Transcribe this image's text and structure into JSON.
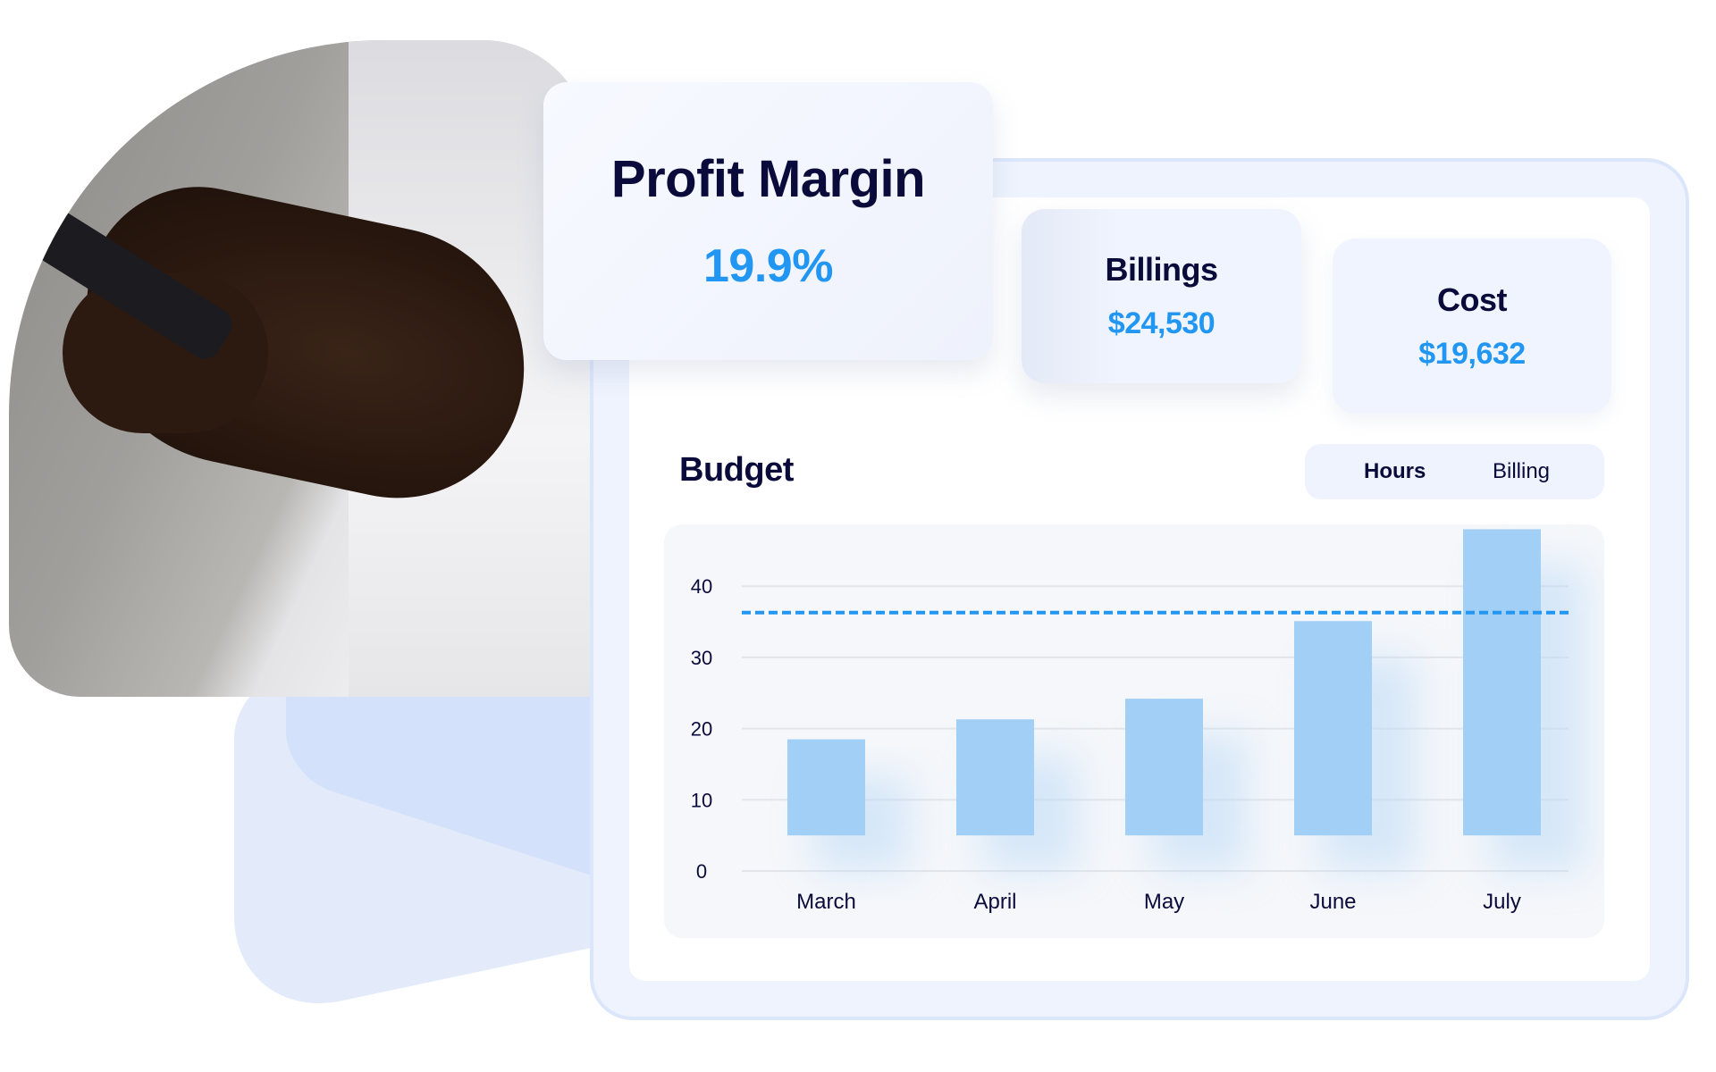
{
  "profit_card": {
    "title": "Profit Margin",
    "value": "19.9%"
  },
  "billings_card": {
    "title": "Billings",
    "value": "$24,530"
  },
  "cost_card": {
    "title": "Cost",
    "value": "$19,632"
  },
  "budget": {
    "title": "Budget",
    "toggle": {
      "options": [
        "Hours",
        "Billing"
      ],
      "selected": "Hours"
    }
  },
  "colors": {
    "accent": "#2196f3",
    "text_dark": "#0b0b3b",
    "bar": "#a2cff5",
    "panel": "#eef3fd"
  },
  "chart_data": {
    "type": "bar",
    "title": "Budget",
    "categories": [
      "March",
      "April",
      "May",
      "June",
      "July"
    ],
    "series": [
      {
        "name": "Hours",
        "values": [
          18.5,
          21.3,
          24.2,
          35.1,
          48
        ]
      }
    ],
    "bar_baseline": 5,
    "reference_line": {
      "value": 36.3,
      "style": "dashed"
    },
    "yticks": [
      0,
      10,
      20,
      30,
      40
    ],
    "ylim": [
      0,
      48
    ],
    "xlabel": "",
    "ylabel": "",
    "grid": true
  }
}
